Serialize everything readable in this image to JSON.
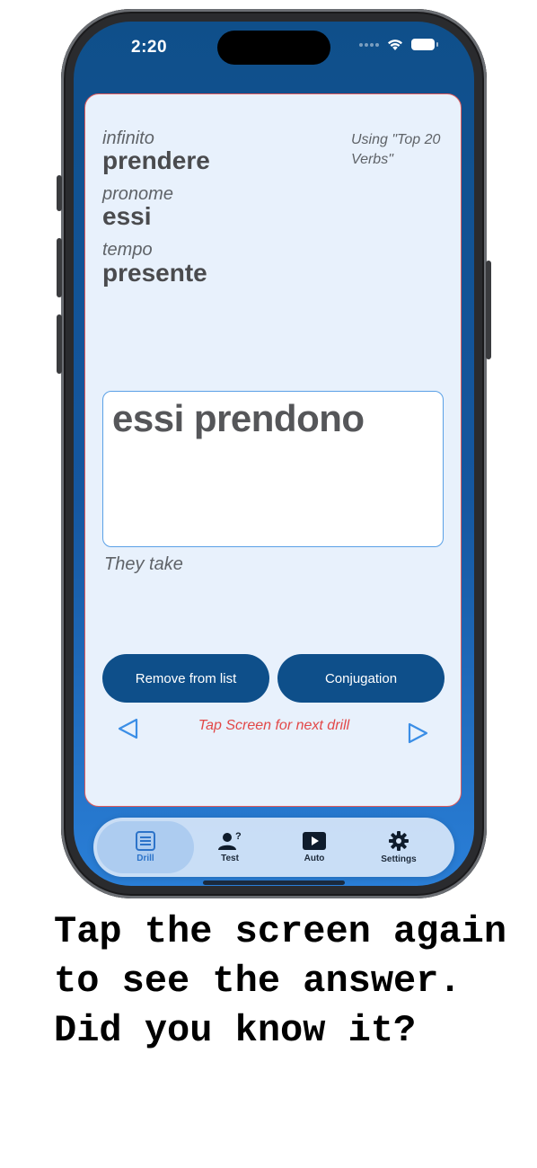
{
  "status_bar": {
    "time": "2:20"
  },
  "card": {
    "infinito_label": "infinito",
    "infinito_value": "prendere",
    "pronome_label": "pronome",
    "pronome_value": "essi",
    "tempo_label": "tempo",
    "tempo_value": "presente",
    "using_list": "Using \"Top 20 Verbs\"",
    "answer": "essi prendono",
    "translation": "They take",
    "remove_button": "Remove from list",
    "conjugation_button": "Conjugation",
    "tap_hint": "Tap Screen for next drill"
  },
  "tabs": [
    {
      "label": "Drill",
      "icon": "list-icon",
      "active": true
    },
    {
      "label": "Test",
      "icon": "person-question-icon",
      "active": false
    },
    {
      "label": "Auto",
      "icon": "play-icon",
      "active": false
    },
    {
      "label": "Settings",
      "icon": "gear-icon",
      "active": false
    }
  ],
  "caption": "Tap the screen again to see the answer. Did you know it?",
  "colors": {
    "accent": "#0e4f8a",
    "active_tab": "#2c73c9",
    "hint_red": "#e24848",
    "card_bg": "#e8f1fc"
  }
}
